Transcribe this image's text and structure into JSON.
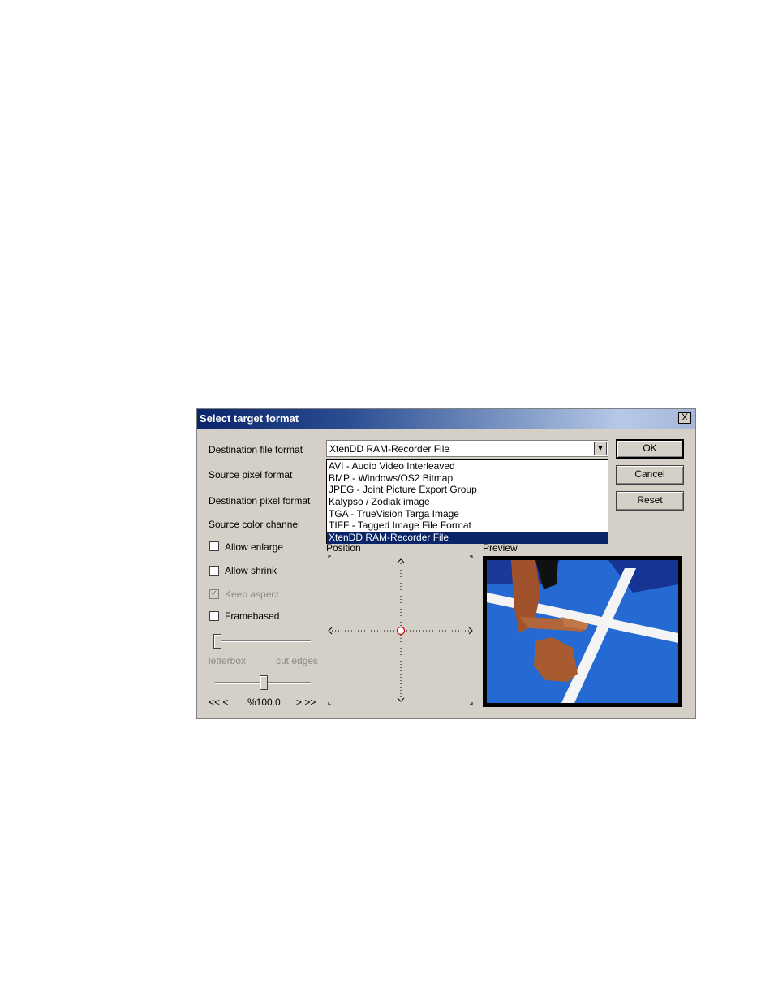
{
  "dialog": {
    "title": "Select target format",
    "close_label": "X"
  },
  "labels": {
    "dest_file_format": "Destination file format",
    "source_pixel_format": "Source pixel format",
    "dest_pixel_format": "Destination pixel format",
    "source_color_channel": "Source color channel",
    "position": "Position",
    "preview": "Preview"
  },
  "combo": {
    "selected": "XtenDD RAM-Recorder File",
    "options": [
      "AVI - Audio Video Interleaved",
      "BMP - Windows/OS2 Bitmap",
      "JPEG - Joint Picture Export Group",
      "Kalypso / Zodiak image",
      "TGA - TrueVision Targa Image",
      "TIFF - Tagged Image File Format",
      "XtenDD RAM-Recorder File"
    ]
  },
  "buttons": {
    "ok": "OK",
    "cancel": "Cancel",
    "reset": "Reset"
  },
  "checkboxes": {
    "allow_enlarge": {
      "label": "Allow enlarge",
      "checked": false
    },
    "allow_shrink": {
      "label": "Allow shrink",
      "checked": false
    },
    "keep_aspect": {
      "label": "Keep aspect",
      "checked": true
    },
    "framebased": {
      "label": "Framebased",
      "checked": false
    }
  },
  "slider1": {
    "left_label": "letterbox",
    "right_label": "cut edges",
    "value": 0
  },
  "slider2": {
    "left_label": "<< <",
    "value_label": "%100.0",
    "right_label": "> >>",
    "value": 0.5
  },
  "colors": {
    "accent": "#0a246a",
    "dialog_bg": "#d4d0c8"
  }
}
